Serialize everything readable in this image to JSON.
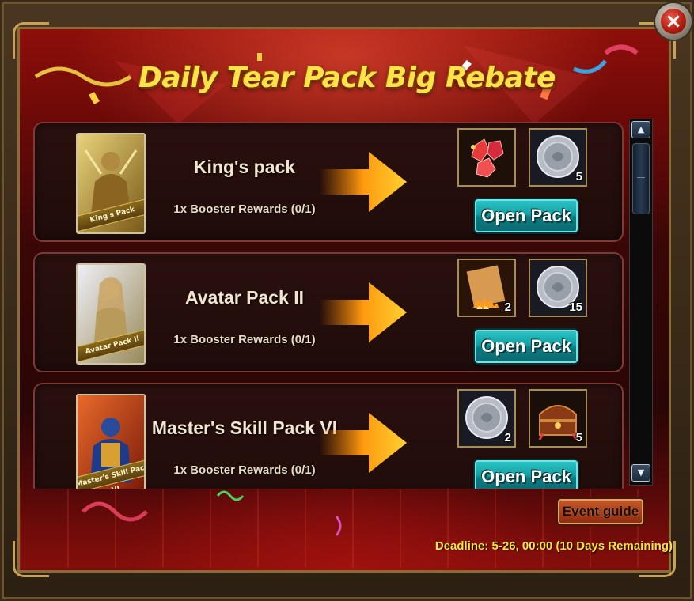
{
  "window": {
    "title": "Daily Tear Pack Big Rebate",
    "close_icon": "×"
  },
  "packs": [
    {
      "name": "King's pack",
      "card_label": "King's Pack",
      "reward_text": "1x Booster Rewards (0/1)",
      "button_label": "Open Pack",
      "rewards": [
        {
          "icon": "ruby-crystals-icon",
          "count": ""
        },
        {
          "icon": "silver-coin-icon",
          "count": "5"
        }
      ]
    },
    {
      "name": "Avatar Pack II",
      "card_label": "Avatar Pack II",
      "reward_text": "1x Booster Rewards (0/1)",
      "button_label": "Open Pack",
      "rewards": [
        {
          "icon": "fire-scroll-icon",
          "count": "2"
        },
        {
          "icon": "silver-coin-icon",
          "count": "15"
        }
      ]
    },
    {
      "name": "Master's Skill Pack VI",
      "card_label": "Master's Skill Pack VI",
      "reward_text": "1x Booster Rewards (0/1)",
      "button_label": "Open Pack",
      "rewards": [
        {
          "icon": "silver-coin-icon",
          "count": "2"
        },
        {
          "icon": "treasure-chest-icon",
          "count": "5"
        }
      ]
    }
  ],
  "scrollbar": {
    "up_icon": "▲",
    "down_icon": "▼"
  },
  "footer": {
    "event_guide_label": "Event guide",
    "deadline": "Deadline: 5-26, 00:00 (10 Days Remaining)"
  },
  "colors": {
    "title": "#ffe14a",
    "open_button": "#139fa4",
    "deadline": "#ffe338",
    "row_border": "#7d3a36"
  }
}
